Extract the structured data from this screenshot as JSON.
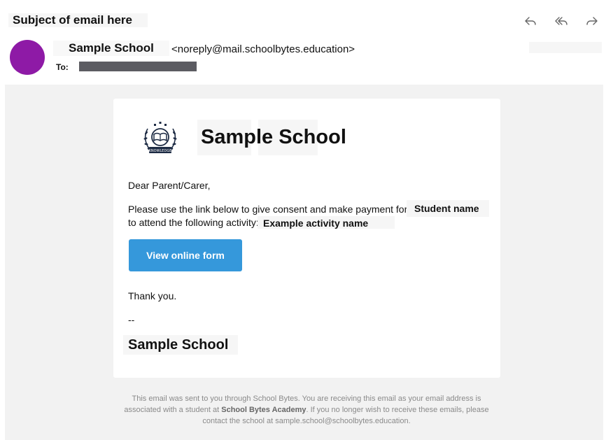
{
  "header": {
    "subject": "Subject of email here",
    "sender_name": "Sample School",
    "sender_email": "<noreply@mail.schoolbytes.education>",
    "to_label": "To:"
  },
  "icons": {
    "reply": "reply-icon",
    "reply_all": "reply-all-icon",
    "forward": "forward-icon",
    "avatar_color": "#8e1aa6"
  },
  "body": {
    "school_name": "Sample School",
    "greeting": "Dear Parent/Carer,",
    "line1": "Please use the link below to give consent and make payment for",
    "student_name": "Student name",
    "line2": "to attend the following activity:",
    "activity_name": "Example activity name",
    "button_label": "View online form",
    "button_color": "#3598db",
    "thanks": "Thank you.",
    "dashes": "--",
    "signature": "Sample School"
  },
  "logo": {
    "text": "KNOWLEDGE"
  },
  "footer": {
    "part1": "This email was sent to you through School Bytes. You are receiving this email as your email address is associated with a student at",
    "academy": "School Bytes Academy",
    "part2": ". If you no longer wish to receive these emails, please contact the school at sample.school@schoolbytes.education."
  }
}
